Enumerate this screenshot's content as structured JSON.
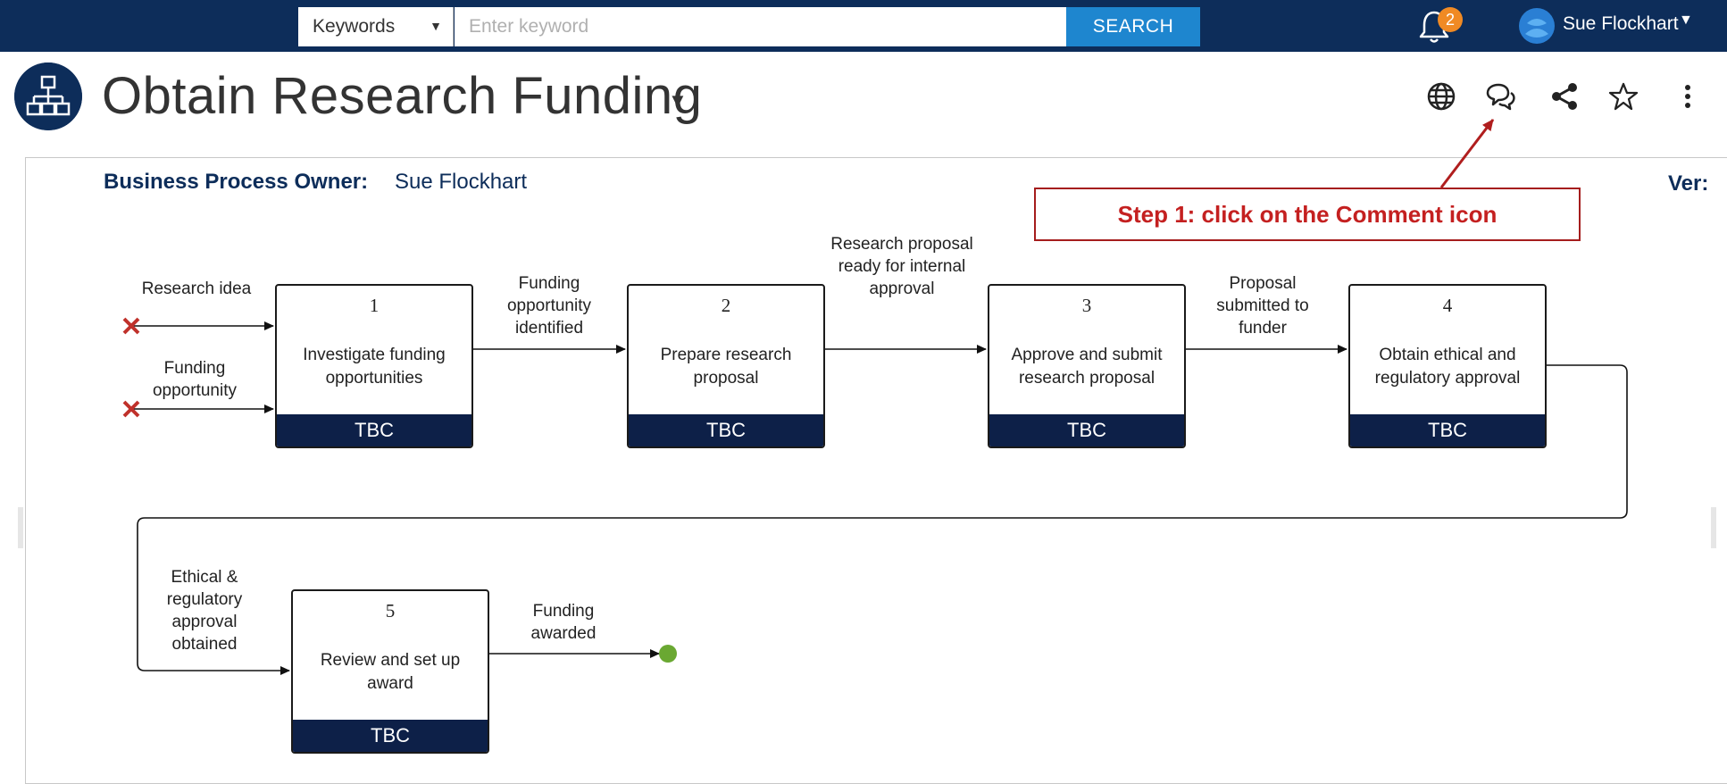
{
  "search": {
    "scope_selected": "Keywords",
    "placeholder": "Enter keyword",
    "value": "",
    "button_label": "SEARCH"
  },
  "notifications": {
    "count": "2"
  },
  "user": {
    "name": "Sue Flockhart"
  },
  "page": {
    "title": "Obtain Research Funding"
  },
  "process": {
    "owner_label": "Business Process Owner:",
    "owner_value": "Sue Flockhart",
    "version_label_partial": "Ver:"
  },
  "callout": {
    "text": "Step 1: click on the Comment icon"
  },
  "steps": [
    {
      "number": "1",
      "name": "Investigate funding opportunities",
      "role": "TBC"
    },
    {
      "number": "2",
      "name": "Prepare research proposal",
      "role": "TBC"
    },
    {
      "number": "3",
      "name": "Approve and submit research proposal",
      "role": "TBC"
    },
    {
      "number": "4",
      "name": "Obtain ethical and regulatory approval",
      "role": "TBC"
    },
    {
      "number": "5",
      "name": "Review and set up award",
      "role": "TBC"
    }
  ],
  "flow_labels": {
    "input_1": "Research idea",
    "input_2": "Funding opportunity",
    "f1_2": "Funding opportunity identified",
    "f2_3": "Research proposal ready for internal approval",
    "f3_4": "Proposal submitted to funder",
    "f4_5": "Ethical & regulatory approval obtained",
    "output": "Funding awarded"
  },
  "colors": {
    "navy": "#0d2d5a",
    "search_button": "#1e86cf",
    "badge": "#f08a24",
    "callout": "#c42020",
    "start_marker": "#c0312b",
    "end_marker": "#6aa832"
  },
  "icons": {
    "notification": "bell-icon",
    "globe": "globe-icon",
    "comment": "comment-icon",
    "share": "share-icon",
    "favorite": "star-icon",
    "more": "more-vertical-icon",
    "process": "process-hierarchy-icon"
  }
}
